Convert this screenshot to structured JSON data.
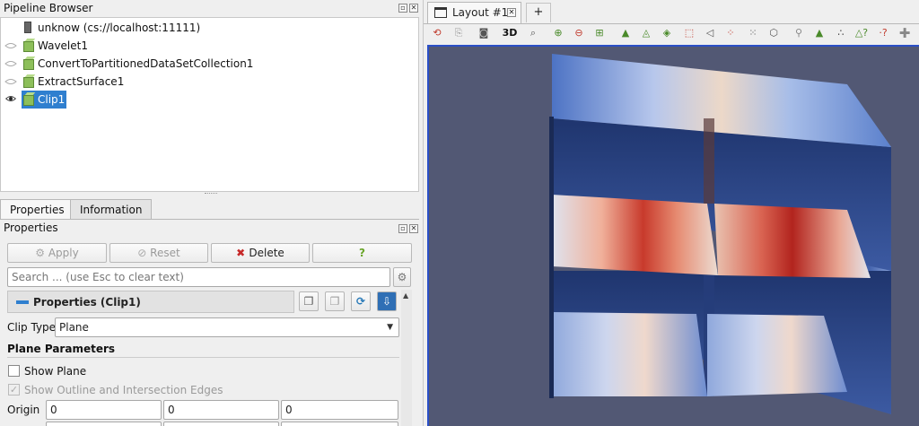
{
  "pipeline": {
    "title": "Pipeline Browser",
    "server": "unknow (cs://localhost:11111)",
    "items": [
      {
        "label": "Wavelet1"
      },
      {
        "label": "ConvertToPartitionedDataSetCollection1"
      },
      {
        "label": "ExtractSurface1"
      },
      {
        "label": "Clip1"
      }
    ]
  },
  "tabs": {
    "properties": "Properties",
    "information": "Information"
  },
  "properties": {
    "title": "Properties",
    "apply": "Apply",
    "reset": "Reset",
    "delete": "Delete",
    "help": "?",
    "search_placeholder": "Search ... (use Esc to clear text)",
    "section_header": "Properties (Clip1)",
    "clip_type_label": "Clip Type",
    "clip_type_value": "Plane",
    "plane_params": "Plane Parameters",
    "show_plane": "Show Plane",
    "show_outline": "Show Outline and Intersection Edges",
    "origin_label": "Origin",
    "origin": [
      "0",
      "0",
      "0"
    ]
  },
  "layout": {
    "tab_label": "Layout #1",
    "add_tab": "+",
    "three_d": "3D"
  },
  "colors": {
    "accent": "#2f7fcf",
    "viewport_bg": "#525874",
    "active_border": "#2b4fc7"
  }
}
